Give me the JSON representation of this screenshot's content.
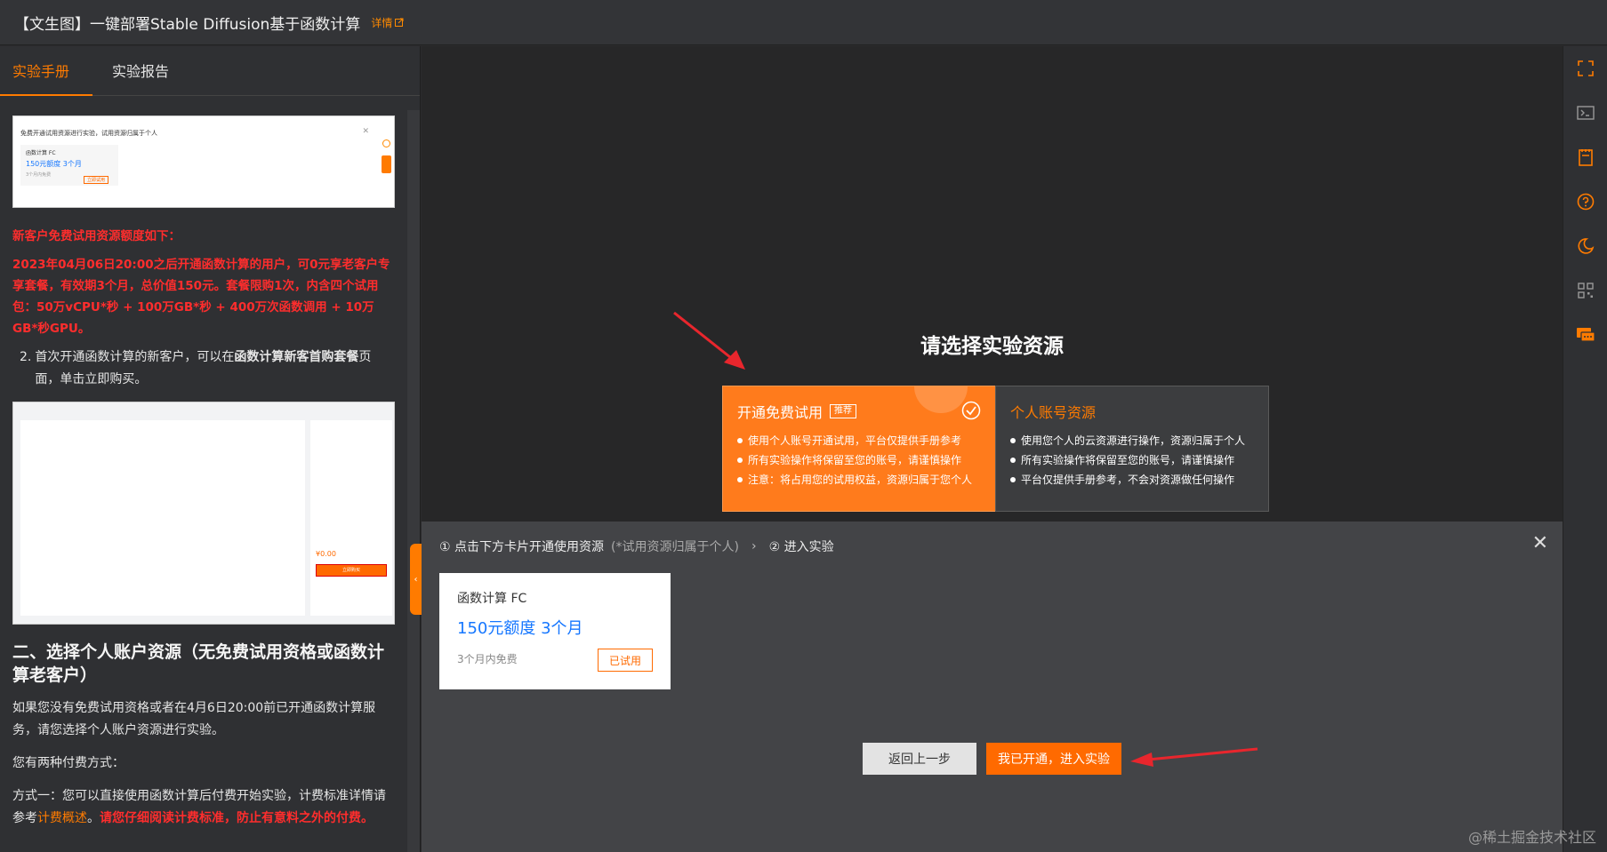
{
  "header": {
    "title": "【文生图】一键部署Stable Diffusion基于函数计算",
    "detail_label": "详情"
  },
  "tabs": [
    {
      "label": "实验手册"
    },
    {
      "label": "实验报告"
    }
  ],
  "manual": {
    "shot1": {
      "notice": "免费开通试用资源进行实验，试用资源归属于个人",
      "card_title": "函数计算 FC",
      "card_quota": "150元额度 3个月",
      "card_sub": "3个月内免费",
      "card_btn": "立即试用"
    },
    "red_heading": "新客户免费试用资源额度如下：",
    "red_body": "2023年04月06日20:00之后开通函数计算的用户，可0元享老客户专享套餐，有效期3个月，总价值150元。套餐限购1次，内含四个试用包：50万vCPU*秒 + 100万GB*秒 + 400万次函数调用 + 10万GB*秒GPU。",
    "item2_num": "2.",
    "item2_a": "首次开通函数计算的新客户，可以在",
    "item2_b": "函数计算新客首购套餐",
    "item2_c": "页面，单击立即购买。",
    "shot2": {
      "price": "¥0.00",
      "buy": "立即购买"
    },
    "section2_title": "二、选择个人账户资源（无免费试用资格或函数计算老客户）",
    "section2_p1": "如果您没有免费试用资格或者在4月6日20:00前已开通函数计算服务，请您选择个人账户资源进行实验。",
    "section2_p2": "您有两种付费方式：",
    "section2_p3a": "方式一：您可以直接使用函数计算后付费开始实验，计费标准详情请参考",
    "section2_p3_link": "计费概述",
    "section2_p3_sep": "。",
    "section2_p3_red": "请您仔细阅读计费标准，防止有意料之外的付费。"
  },
  "choose": {
    "title": "请选择实验资源",
    "free": {
      "title": "开通免费试用",
      "badge": "推荐",
      "items": [
        "使用个人账号开通试用，平台仅提供手册参考",
        "所有实验操作将保留至您的账号，请谨慎操作",
        "注意：将占用您的试用权益，资源归属于您个人"
      ]
    },
    "personal": {
      "title": "个人账号资源",
      "items": [
        "使用您个人的云资源进行操作，资源归属于个人",
        "所有实验操作将保留至您的账号，请谨慎操作",
        "平台仅提供手册参考，不会对资源做任何操作"
      ]
    }
  },
  "panel": {
    "step1": "① 点击下方卡片开通使用资源",
    "step1_hint": "(*试用资源归属于个人)",
    "step_sep": "›",
    "step2": "② 进入实验",
    "resource": {
      "name": "函数计算 FC",
      "quota": "150元额度 3个月",
      "sub": "3个月内免费",
      "btn": "已试用"
    },
    "back_label": "返回上一步",
    "enter_label": "我已开通，进入实验"
  },
  "watermark": "@稀土掘金技术社区",
  "colors": {
    "accent": "#ff7b00",
    "red_text": "#ff2d2d",
    "link": "#1677ff",
    "arrow": "#e8262d"
  }
}
